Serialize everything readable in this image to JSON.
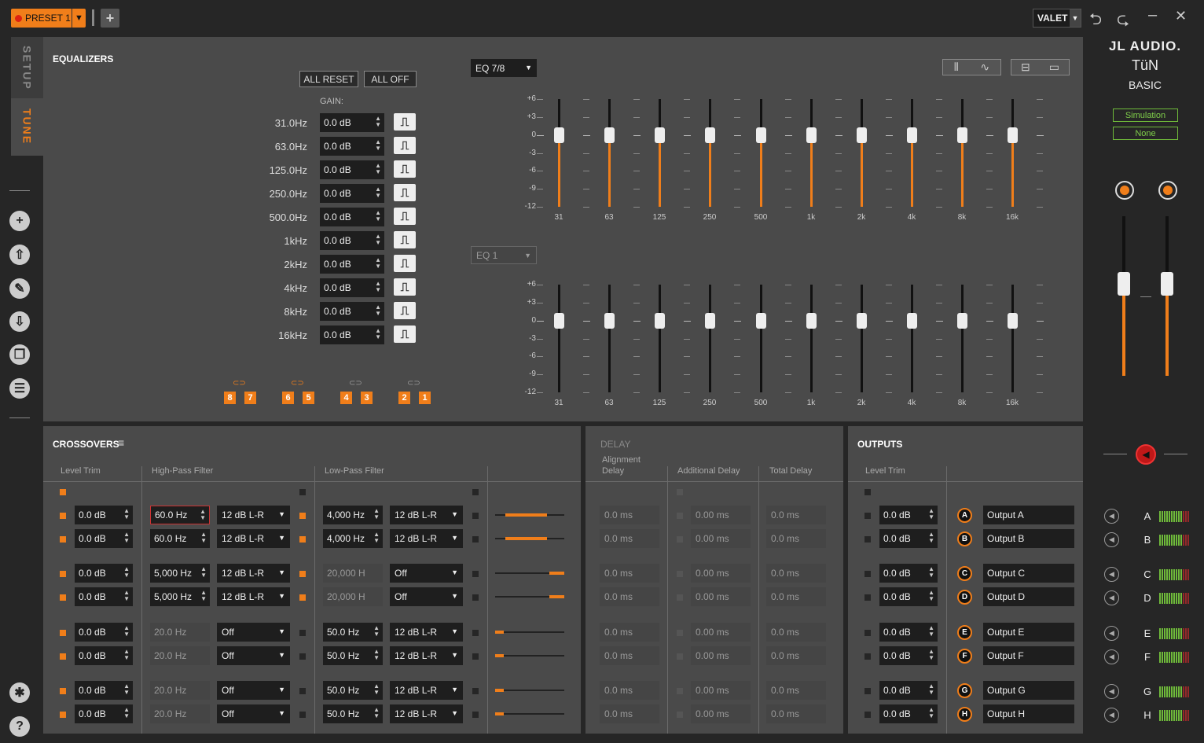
{
  "topbar": {
    "preset_label": "PRESET 1",
    "valet_label": "VALET"
  },
  "sidebar": {
    "tabs": [
      "SETUP",
      "TUNE"
    ],
    "icons": [
      "add-icon",
      "upload-icon",
      "wrench-icon",
      "download-icon",
      "copy-icon",
      "list-icon",
      "settings-icon",
      "help-icon"
    ]
  },
  "equalizers": {
    "title": "EQUALIZERS",
    "all_reset": "ALL RESET",
    "all_off": "ALL OFF",
    "gain_label": "GAIN:",
    "bands": [
      {
        "freq": "31.0Hz",
        "gain": "0.0 dB"
      },
      {
        "freq": "63.0Hz",
        "gain": "0.0 dB"
      },
      {
        "freq": "125.0Hz",
        "gain": "0.0 dB"
      },
      {
        "freq": "250.0Hz",
        "gain": "0.0 dB"
      },
      {
        "freq": "500.0Hz",
        "gain": "0.0 dB"
      },
      {
        "freq": "1kHz",
        "gain": "0.0 dB"
      },
      {
        "freq": "2kHz",
        "gain": "0.0 dB"
      },
      {
        "freq": "4kHz",
        "gain": "0.0 dB"
      },
      {
        "freq": "8kHz",
        "gain": "0.0 dB"
      },
      {
        "freq": "16kHz",
        "gain": "0.0 dB"
      }
    ],
    "bell_glyph": "⎍",
    "link_glyph": "⊂⊃",
    "channel_pairs": [
      [
        "8",
        "7"
      ],
      [
        "6",
        "5"
      ],
      [
        "4",
        "3"
      ],
      [
        "2",
        "1"
      ]
    ],
    "top_select": "EQ 7/8",
    "bottom_select": "EQ 1",
    "y_labels": [
      "+6",
      "+3",
      "0",
      "-3",
      "-6",
      "-9",
      "-12"
    ],
    "x_labels": [
      "31",
      "63",
      "125",
      "250",
      "500",
      "1k",
      "2k",
      "4k",
      "8k",
      "16k"
    ],
    "top_slider_gains_db": [
      0,
      0,
      0,
      0,
      0,
      0,
      0,
      0,
      0,
      0
    ],
    "bottom_slider_gains_db": [
      0,
      0,
      0,
      0,
      0,
      0,
      0,
      0,
      0,
      0
    ]
  },
  "crossovers": {
    "title": "CROSSOVERS",
    "menu_glyph": "≡",
    "headers": {
      "level": "Level Trim",
      "hpf": "High-Pass Filter",
      "lpf": "Low-Pass Filter"
    },
    "rows": [
      {
        "level": "0.0 dB",
        "hp_freq": "60.0 Hz",
        "hp_slope": "12 dB L-R",
        "lp_freq": "4,000 Hz",
        "lp_slope": "12 dB L-R",
        "hp_on": true,
        "lp_on": false,
        "pass_band": [
          0.15,
          0.75
        ]
      },
      {
        "level": "0.0 dB",
        "hp_freq": "60.0 Hz",
        "hp_slope": "12 dB L-R",
        "lp_freq": "4,000 Hz",
        "lp_slope": "12 dB L-R",
        "hp_on": true,
        "lp_on": false,
        "pass_band": [
          0.15,
          0.75
        ]
      },
      {
        "level": "0.0 dB",
        "hp_freq": "5,000 Hz",
        "hp_slope": "12 dB L-R",
        "lp_freq": "20,000 H",
        "lp_slope": "Off",
        "hp_on": true,
        "lp_on": false,
        "pass_band": [
          0.78,
          1.0
        ]
      },
      {
        "level": "0.0 dB",
        "hp_freq": "5,000 Hz",
        "hp_slope": "12 dB L-R",
        "lp_freq": "20,000 H",
        "lp_slope": "Off",
        "hp_on": true,
        "lp_on": false,
        "pass_band": [
          0.78,
          1.0
        ]
      },
      {
        "level": "0.0 dB",
        "hp_freq": "20.0 Hz",
        "hp_slope": "Off",
        "lp_freq": "50.0 Hz",
        "lp_slope": "12 dB L-R",
        "hp_on": false,
        "lp_on": false,
        "pass_band": [
          0.0,
          0.12
        ]
      },
      {
        "level": "0.0 dB",
        "hp_freq": "20.0 Hz",
        "hp_slope": "Off",
        "lp_freq": "50.0 Hz",
        "lp_slope": "12 dB L-R",
        "hp_on": false,
        "lp_on": false,
        "pass_band": [
          0.0,
          0.12
        ]
      },
      {
        "level": "0.0 dB",
        "hp_freq": "20.0 Hz",
        "hp_slope": "Off",
        "lp_freq": "50.0 Hz",
        "lp_slope": "12 dB L-R",
        "hp_on": false,
        "lp_on": false,
        "pass_band": [
          0.0,
          0.12
        ]
      },
      {
        "level": "0.0 dB",
        "hp_freq": "20.0 Hz",
        "hp_slope": "Off",
        "lp_freq": "50.0 Hz",
        "lp_slope": "12 dB L-R",
        "hp_on": false,
        "lp_on": false,
        "pass_band": [
          0.0,
          0.12
        ]
      }
    ]
  },
  "delay": {
    "title": "DELAY",
    "headers": {
      "alignment": "Alignment Delay",
      "additional": "Additional Delay",
      "total": "Total Delay"
    },
    "rows": [
      {
        "align": "0.0 ms",
        "additional": "0.00 ms",
        "total": "0.0 ms"
      },
      {
        "align": "0.0 ms",
        "additional": "0.00 ms",
        "total": "0.0 ms"
      },
      {
        "align": "0.0 ms",
        "additional": "0.00 ms",
        "total": "0.0 ms"
      },
      {
        "align": "0.0 ms",
        "additional": "0.00 ms",
        "total": "0.0 ms"
      },
      {
        "align": "0.0 ms",
        "additional": "0.00 ms",
        "total": "0.0 ms"
      },
      {
        "align": "0.0 ms",
        "additional": "0.00 ms",
        "total": "0.0 ms"
      },
      {
        "align": "0.0 ms",
        "additional": "0.00 ms",
        "total": "0.0 ms"
      },
      {
        "align": "0.0 ms",
        "additional": "0.00 ms",
        "total": "0.0 ms"
      }
    ]
  },
  "outputs": {
    "title": "OUTPUTS",
    "level_header": "Level Trim",
    "rows": [
      {
        "level": "0.0 dB",
        "letter": "A",
        "name": "Output A"
      },
      {
        "level": "0.0 dB",
        "letter": "B",
        "name": "Output B"
      },
      {
        "level": "0.0 dB",
        "letter": "C",
        "name": "Output C"
      },
      {
        "level": "0.0 dB",
        "letter": "D",
        "name": "Output D"
      },
      {
        "level": "0.0 dB",
        "letter": "E",
        "name": "Output E"
      },
      {
        "level": "0.0 dB",
        "letter": "F",
        "name": "Output F"
      },
      {
        "level": "0.0 dB",
        "letter": "G",
        "name": "Output G"
      },
      {
        "level": "0.0 dB",
        "letter": "H",
        "name": "Output H"
      }
    ]
  },
  "right_panel": {
    "brand_line1": "JL AUDIO.",
    "brand_line2": "TüN",
    "brand_line3": "BASIC",
    "simulation": "Simulation",
    "none": "None",
    "master_levels": [
      0.58,
      0.58
    ],
    "channels": [
      "A",
      "B",
      "C",
      "D",
      "E",
      "F",
      "G",
      "H"
    ]
  },
  "colors": {
    "accent": "#f07e1a",
    "panel": "#4a4a4a",
    "background": "#262626",
    "meter_green": "#6fba3a",
    "meter_red": "#b02a2a"
  }
}
